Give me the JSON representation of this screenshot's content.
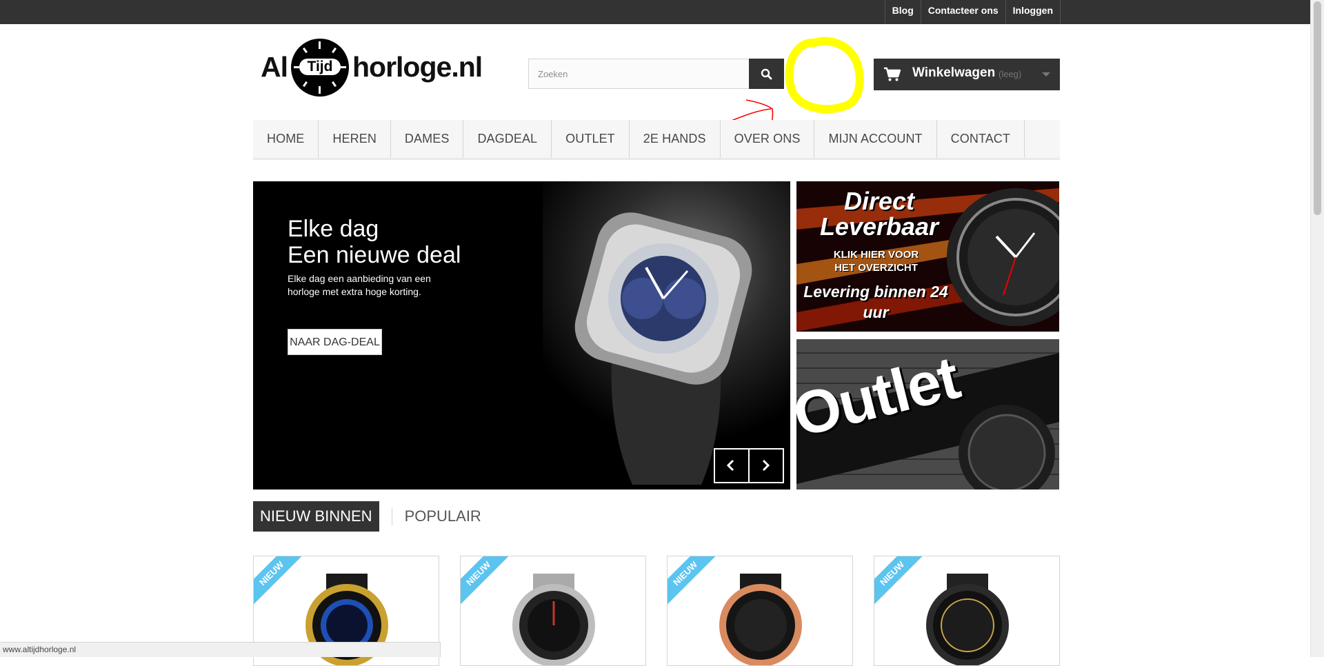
{
  "topbar": {
    "links": [
      "Blog",
      "Contacteer ons",
      "Inloggen"
    ]
  },
  "logo": {
    "part1": "Al",
    "clock_label": "Tijd",
    "part2": "horloge.nl"
  },
  "search": {
    "placeholder": "Zoeken",
    "value": ""
  },
  "cart": {
    "label": "Winkelwagen",
    "status": "(leeg)"
  },
  "nav": {
    "items": [
      "HOME",
      "HEREN",
      "DAMES",
      "DAGDEAL",
      "OUTLET",
      "2E HANDS",
      "OVER ONS",
      "MIJN ACCOUNT",
      "CONTACT"
    ]
  },
  "slider": {
    "title_line1": "Elke dag",
    "title_line2": "Een nieuwe deal",
    "text": "Elke dag een aanbieding van een horloge met extra hoge korting.",
    "button": "NAAR DAG-DEAL"
  },
  "banner1": {
    "title": "Direct Leverbaar",
    "subtitle": "KLIK HIER VOOR HET OVERZICHT",
    "delivery": "Levering binnen 24 uur"
  },
  "banner2": {
    "title": "Outlet"
  },
  "tabs": {
    "active": "NIEUW BINNEN",
    "other": "POPULAIR"
  },
  "products": [
    {
      "badge": "NIEUW",
      "accent": "#1e4fb5"
    },
    {
      "badge": "NIEUW",
      "accent": "#c0392b"
    },
    {
      "badge": "NIEUW",
      "accent": "#d98b5f"
    },
    {
      "badge": "NIEUW",
      "accent": "#c9a54a"
    }
  ],
  "statusbar": {
    "url": "www.altijdhorloge.nl"
  },
  "colors": {
    "topbar": "#333333",
    "accent_ribbon": "#5bc4ef",
    "annotation_yellow": "#ffff00",
    "annotation_red": "#ff0000"
  }
}
